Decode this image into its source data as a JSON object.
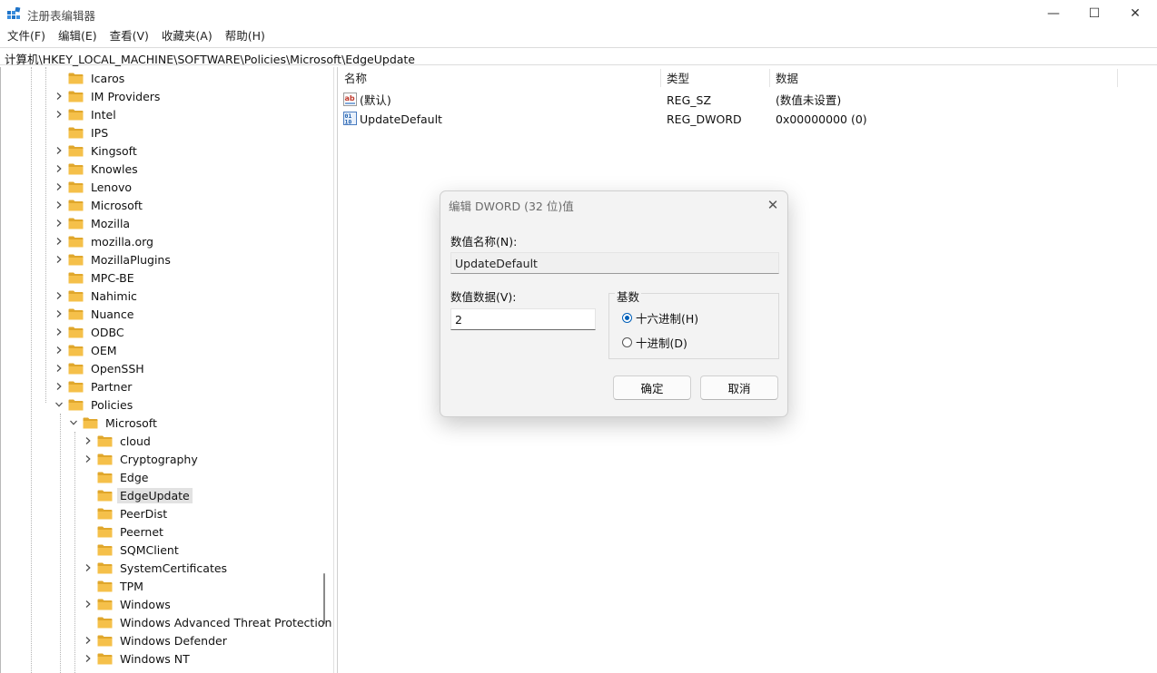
{
  "window": {
    "title": "注册表编辑器",
    "controls": {
      "minimize": "—",
      "maximize": "☐",
      "close": "✕"
    }
  },
  "menu": [
    "文件(F)",
    "编辑(E)",
    "查看(V)",
    "收藏夹(A)",
    "帮助(H)"
  ],
  "address": "计算机\\HKEY_LOCAL_MACHINE\\SOFTWARE\\Policies\\Microsoft\\EdgeUpdate",
  "tree": {
    "top_level": [
      {
        "label": "Icaros",
        "expandable": false
      },
      {
        "label": "IM Providers",
        "expandable": true
      },
      {
        "label": "Intel",
        "expandable": true
      },
      {
        "label": "IPS",
        "expandable": false
      },
      {
        "label": "Kingsoft",
        "expandable": true
      },
      {
        "label": "Knowles",
        "expandable": true
      },
      {
        "label": "Lenovo",
        "expandable": true
      },
      {
        "label": "Microsoft",
        "expandable": true
      },
      {
        "label": "Mozilla",
        "expandable": true
      },
      {
        "label": "mozilla.org",
        "expandable": true
      },
      {
        "label": "MozillaPlugins",
        "expandable": true
      },
      {
        "label": "MPC-BE",
        "expandable": false
      },
      {
        "label": "Nahimic",
        "expandable": true
      },
      {
        "label": "Nuance",
        "expandable": true
      },
      {
        "label": "ODBC",
        "expandable": true
      },
      {
        "label": "OEM",
        "expandable": true
      },
      {
        "label": "OpenSSH",
        "expandable": true
      },
      {
        "label": "Partner",
        "expandable": true
      },
      {
        "label": "Policies",
        "expandable": true,
        "expanded": true
      }
    ],
    "policies_child": {
      "label": "Microsoft",
      "expanded": true
    },
    "microsoft_children": [
      {
        "label": "cloud",
        "expandable": true
      },
      {
        "label": "Cryptography",
        "expandable": true
      },
      {
        "label": "Edge",
        "expandable": false
      },
      {
        "label": "EdgeUpdate",
        "expandable": false,
        "selected": true
      },
      {
        "label": "PeerDist",
        "expandable": false
      },
      {
        "label": "Peernet",
        "expandable": false
      },
      {
        "label": "SQMClient",
        "expandable": false
      },
      {
        "label": "SystemCertificates",
        "expandable": true
      },
      {
        "label": "TPM",
        "expandable": false
      },
      {
        "label": "Windows",
        "expandable": true
      },
      {
        "label": "Windows Advanced Threat Protection",
        "expandable": false
      },
      {
        "label": "Windows Defender",
        "expandable": true
      },
      {
        "label": "Windows NT",
        "expandable": true
      }
    ]
  },
  "list": {
    "columns": [
      "名称",
      "类型",
      "数据"
    ],
    "rows": [
      {
        "name": "(默认)",
        "type": "REG_SZ",
        "data": "(数值未设置)",
        "icon": "string-value-icon"
      },
      {
        "name": "UpdateDefault",
        "type": "REG_DWORD",
        "data": "0x00000000 (0)",
        "icon": "binary-value-icon"
      }
    ]
  },
  "dialog": {
    "title": "编辑 DWORD (32 位)值",
    "close": "✕",
    "name_label": "数值名称(N):",
    "name_value": "UpdateDefault",
    "data_label": "数值数据(V):",
    "data_value": "2",
    "base_label": "基数",
    "hex_label": "十六进制(H)",
    "dec_label": "十进制(D)",
    "selected_base": "hex",
    "ok": "确定",
    "cancel": "取消"
  },
  "colors": {
    "folder": "#f5c04a",
    "folder_dark": "#e0a72c",
    "accent": "#005fb8"
  }
}
